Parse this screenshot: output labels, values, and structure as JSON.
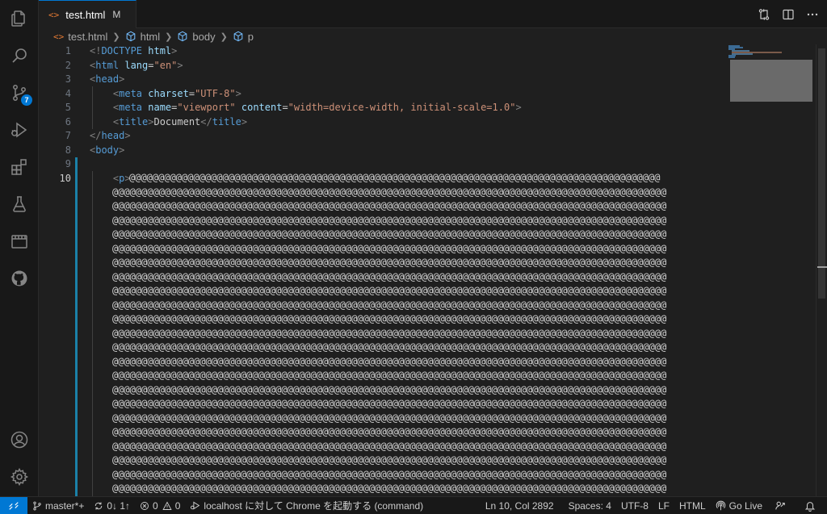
{
  "activity_bar": {
    "icons": [
      "explorer-icon",
      "search-icon",
      "source-control-icon",
      "run-debug-icon",
      "extensions-icon",
      "testing-icon",
      "notebook-icon",
      "github-icon"
    ],
    "source_control_badge": "7",
    "bottom_icons": [
      "account-icon",
      "manage-gear-icon"
    ]
  },
  "tab": {
    "icon": "<>",
    "label": "test.html",
    "modified": "M"
  },
  "breadcrumb": {
    "file_icon": "<>",
    "items": [
      "test.html",
      "html",
      "body",
      "p"
    ]
  },
  "editor": {
    "line_numbers": [
      "1",
      "2",
      "3",
      "4",
      "5",
      "6",
      "7",
      "8",
      "9",
      "10"
    ],
    "lines": [
      [
        {
          "t": "<!",
          "c": "punct"
        },
        {
          "t": "DOCTYPE ",
          "c": "tag"
        },
        {
          "t": "html",
          "c": "attr"
        },
        {
          "t": ">",
          "c": "punct"
        }
      ],
      [
        {
          "t": "<",
          "c": "punct"
        },
        {
          "t": "html ",
          "c": "tag"
        },
        {
          "t": "lang",
          "c": "attr"
        },
        {
          "t": "=",
          "c": "text"
        },
        {
          "t": "\"en\"",
          "c": "str"
        },
        {
          "t": ">",
          "c": "punct"
        }
      ],
      [
        {
          "t": "<",
          "c": "punct"
        },
        {
          "t": "head",
          "c": "tag"
        },
        {
          "t": ">",
          "c": "punct"
        }
      ],
      [
        {
          "t": "    <",
          "c": "punct"
        },
        {
          "t": "meta ",
          "c": "tag"
        },
        {
          "t": "charset",
          "c": "attr"
        },
        {
          "t": "=",
          "c": "text"
        },
        {
          "t": "\"UTF-8\"",
          "c": "str"
        },
        {
          "t": ">",
          "c": "punct"
        }
      ],
      [
        {
          "t": "    <",
          "c": "punct"
        },
        {
          "t": "meta ",
          "c": "tag"
        },
        {
          "t": "name",
          "c": "attr"
        },
        {
          "t": "=",
          "c": "text"
        },
        {
          "t": "\"viewport\"",
          "c": "str"
        },
        {
          "t": " content",
          "c": "attr"
        },
        {
          "t": "=",
          "c": "text"
        },
        {
          "t": "\"width=device-width, initial-scale=1.0\"",
          "c": "str"
        },
        {
          "t": ">",
          "c": "punct"
        }
      ],
      [
        {
          "t": "    <",
          "c": "punct"
        },
        {
          "t": "title",
          "c": "tag"
        },
        {
          "t": ">",
          "c": "punct"
        },
        {
          "t": "Document",
          "c": "text"
        },
        {
          "t": "</",
          "c": "punct"
        },
        {
          "t": "title",
          "c": "tag"
        },
        {
          "t": ">",
          "c": "punct"
        }
      ],
      [
        {
          "t": "</",
          "c": "punct"
        },
        {
          "t": "head",
          "c": "tag"
        },
        {
          "t": ">",
          "c": "punct"
        }
      ],
      [
        {
          "t": "<",
          "c": "punct"
        },
        {
          "t": "body",
          "c": "tag"
        },
        {
          "t": ">",
          "c": "punct"
        }
      ],
      [],
      [
        {
          "t": "    <",
          "c": "punct"
        },
        {
          "t": "p",
          "c": "tag"
        },
        {
          "t": ">",
          "c": "punct"
        }
      ]
    ],
    "p_content_glyph": "@",
    "p_first_line_chars": 91,
    "p_wrap_line_chars": 95,
    "p_wrap_line_count": 22
  },
  "status_bar": {
    "branch": "master*+",
    "sync": "0↓ 1↑",
    "errors": "0",
    "warnings": "0",
    "launch": "localhost に対して Chrome を起動する (command)",
    "position": "Ln 10, Col 2892",
    "spaces": "Spaces: 4",
    "encoding": "UTF-8",
    "eol": "LF",
    "language": "HTML",
    "go_live": "Go Live"
  },
  "colors": {
    "accent": "#0078d4",
    "tag": "#569cd6",
    "attr": "#9cdcfe",
    "string": "#ce9178",
    "file_icon": "#e37933"
  }
}
